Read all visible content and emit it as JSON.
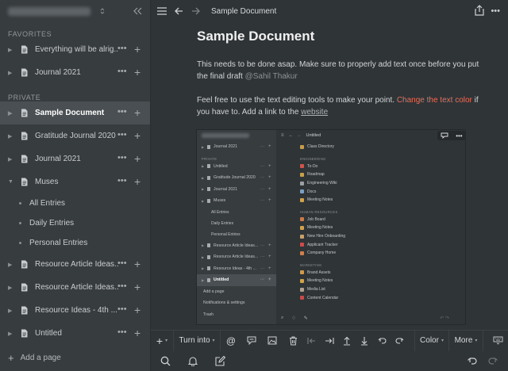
{
  "sidebar": {
    "favorites_label": "FAVORITES",
    "private_label": "PRIVATE",
    "favorites": [
      {
        "label": "Everything will be alrig..."
      },
      {
        "label": "Journal 2021"
      }
    ],
    "private": [
      {
        "label": "Sample Document",
        "active": true
      },
      {
        "label": "Gratitude Journal 2020"
      },
      {
        "label": "Journal 2021"
      },
      {
        "label": "Muses"
      }
    ],
    "muses_children": [
      "All Entries",
      "Daily Entries",
      "Personal Entries"
    ],
    "more_private": [
      {
        "label": "Resource Article Ideas..."
      },
      {
        "label": "Resource Article Ideas..."
      },
      {
        "label": "Resource Ideas - 4th ..."
      },
      {
        "label": "Untitled"
      }
    ],
    "add_page": "Add a page",
    "more_glyph": "•••",
    "add_glyph": "+"
  },
  "topbar": {
    "doc_title": "Sample Document"
  },
  "document": {
    "title": "Sample Document",
    "para1_text": "This needs to be done asap. Make sure to properly add text once before you put the final draft",
    "para1_mention": "@Sahil Thakur",
    "para2_a": "Feel free to use the text editing tools to make your point.",
    "para2_red": "Change the text color",
    "para2_b": "if you have to. Add a link to the",
    "para2_link": "website"
  },
  "embedded": {
    "sidebar_items": [
      {
        "label": "Journal 2021"
      },
      {
        "label": "PRIVATE",
        "section": true
      },
      {
        "label": "Untitled"
      },
      {
        "label": "Gratitude Journal 2020"
      },
      {
        "label": "Journal 2021"
      },
      {
        "label": "Muses"
      },
      {
        "label": "All Entries",
        "sub": true
      },
      {
        "label": "Daily Entries",
        "sub": true
      },
      {
        "label": "Personal Entries",
        "sub": true
      },
      {
        "label": "Resource Article Ideas..."
      },
      {
        "label": "Resource Article Ideas..."
      },
      {
        "label": "Resource Ideas - 4th ..."
      },
      {
        "label": "Untitled",
        "active": true
      },
      {
        "label": "Add a page",
        "plain": true
      },
      {
        "label": "Notifications & settings",
        "plain": true
      },
      {
        "label": "Trash",
        "plain": true
      }
    ],
    "crumb": "Untitled",
    "list": [
      {
        "label": "Class Directory",
        "color": "#c99a4a"
      },
      {
        "label": "ENGINEERING",
        "section": true
      },
      {
        "label": "To-Do",
        "color": "#d0554a"
      },
      {
        "label": "Roadmap",
        "color": "#c9a04a"
      },
      {
        "label": "Engineering Wiki",
        "color": "#9aa0a4"
      },
      {
        "label": "Docs",
        "color": "#7aa0c4"
      },
      {
        "label": "Meeting Notes",
        "color": "#d2a24a"
      },
      {
        "label": "HUMAN RESOURCES",
        "section": true
      },
      {
        "label": "Job Board",
        "color": "#c97a4a"
      },
      {
        "label": "Meeting Notes",
        "color": "#d2a24a"
      },
      {
        "label": "New Hire Onboarding",
        "color": "#c9a06a"
      },
      {
        "label": "Applicant Tracker",
        "color": "#d04a4a"
      },
      {
        "label": "Company Home",
        "color": "#d0804a"
      },
      {
        "label": "MARKETING",
        "section": true
      },
      {
        "label": "Brand Assets",
        "color": "#d09a4a"
      },
      {
        "label": "Meeting Notes",
        "color": "#d2a24a"
      },
      {
        "label": "Media List",
        "color": "#b0a090"
      },
      {
        "label": "Content Calendar",
        "color": "#c94a4a"
      }
    ]
  },
  "toolbar": {
    "turn_into": "Turn into",
    "at_glyph": "@",
    "color": "Color",
    "more": "More"
  }
}
